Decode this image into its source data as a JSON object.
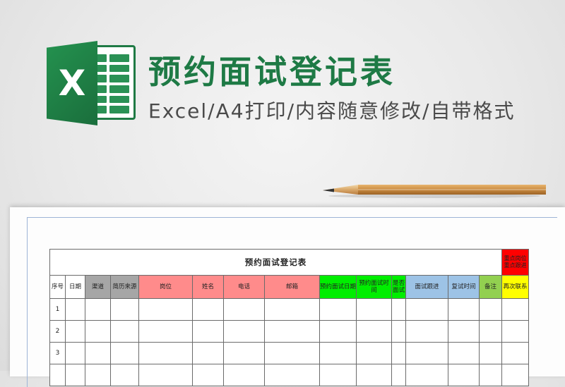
{
  "brand": {
    "logo_letter": "X",
    "logo_color": "#1e7a45"
  },
  "heading": {
    "title": "预约面试登记表",
    "subtitle": "Excel/A4打印/内容随意修改/自带格式"
  },
  "sheet": {
    "title": "预约面试登记表",
    "note": [
      "重点岗位",
      "重点跟进"
    ],
    "columns": [
      {
        "label": "序号",
        "color": "#ffffff"
      },
      {
        "label": "日期",
        "color": "#ffffff"
      },
      {
        "label": "渠道",
        "color": "#a6a6a6"
      },
      {
        "label": "简历来源",
        "color": "#a6a6a6"
      },
      {
        "label": "岗位",
        "color": "#ff8b8b"
      },
      {
        "label": "姓名",
        "color": "#ff8b8b"
      },
      {
        "label": "电话",
        "color": "#ff8b8b"
      },
      {
        "label": "邮箱",
        "color": "#ff8b8b"
      },
      {
        "label": "预约面试日期",
        "color": "#00ee00"
      },
      {
        "label": "预约面试时间",
        "color": "#00ee00"
      },
      {
        "label": "是否面试",
        "color": "#00ee00"
      },
      {
        "label": "面试跟进",
        "color": "#9dc3e6"
      },
      {
        "label": "复试时间",
        "color": "#9dc3e6"
      },
      {
        "label": "备注",
        "color": "#92d050"
      },
      {
        "label": "再次联系",
        "color": "#ffff00"
      }
    ],
    "rows": [
      {
        "index": "1"
      },
      {
        "index": "2"
      },
      {
        "index": "3"
      }
    ]
  }
}
